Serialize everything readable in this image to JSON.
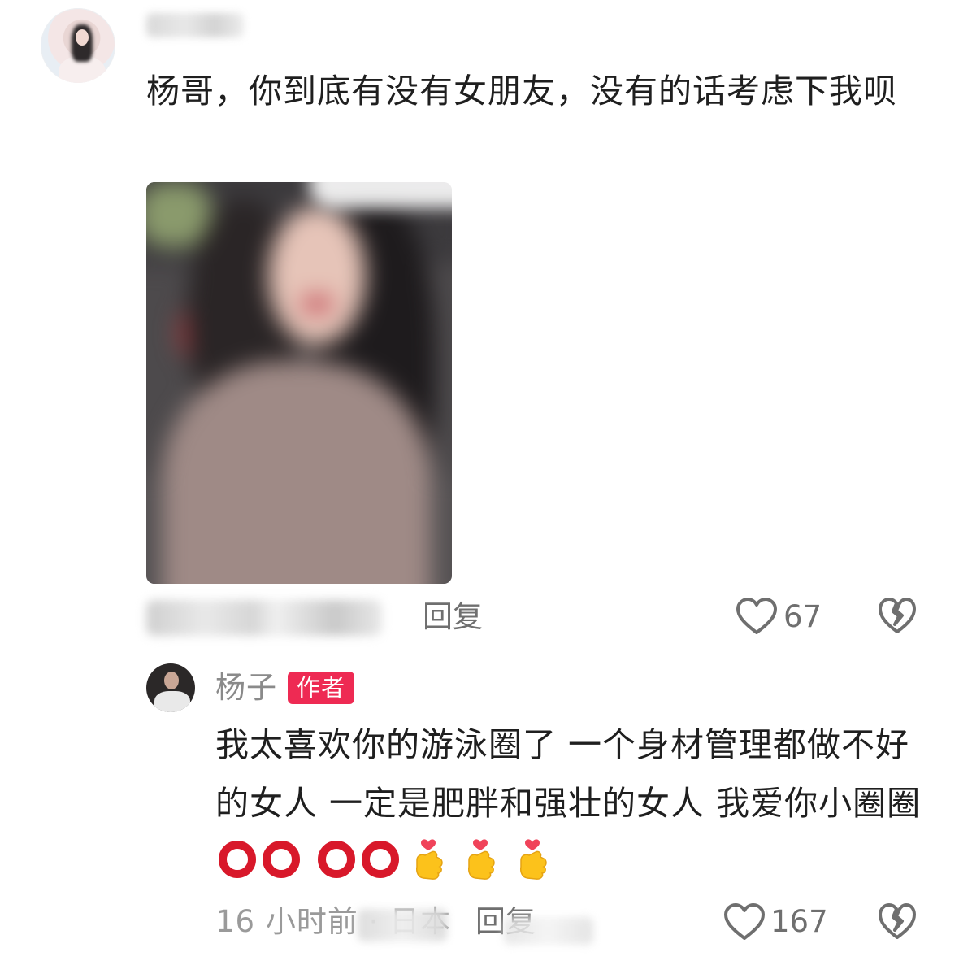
{
  "comment": {
    "text": "杨哥，你到底有没有女朋友，没有的话考虑下我呗",
    "reply_label": "回复",
    "likes": "67"
  },
  "author_reply": {
    "name": "杨子",
    "badge": "作者",
    "text_part1": "我太喜欢你的游泳圈了 一个身材管理都做不好的女人 一定是肥胖和强壮的女人 我爱你小圈圈",
    "time_location": "16 小时前 · 日本",
    "reply_label": "回复",
    "likes": "167"
  },
  "colors": {
    "badge": "#ee2a53",
    "ring": "#d8182a",
    "muted_text": "#6f6f6f"
  },
  "icons": [
    "heart-outline-icon",
    "broken-heart-icon",
    "finger-heart-emoji",
    "red-circle-emoji"
  ]
}
